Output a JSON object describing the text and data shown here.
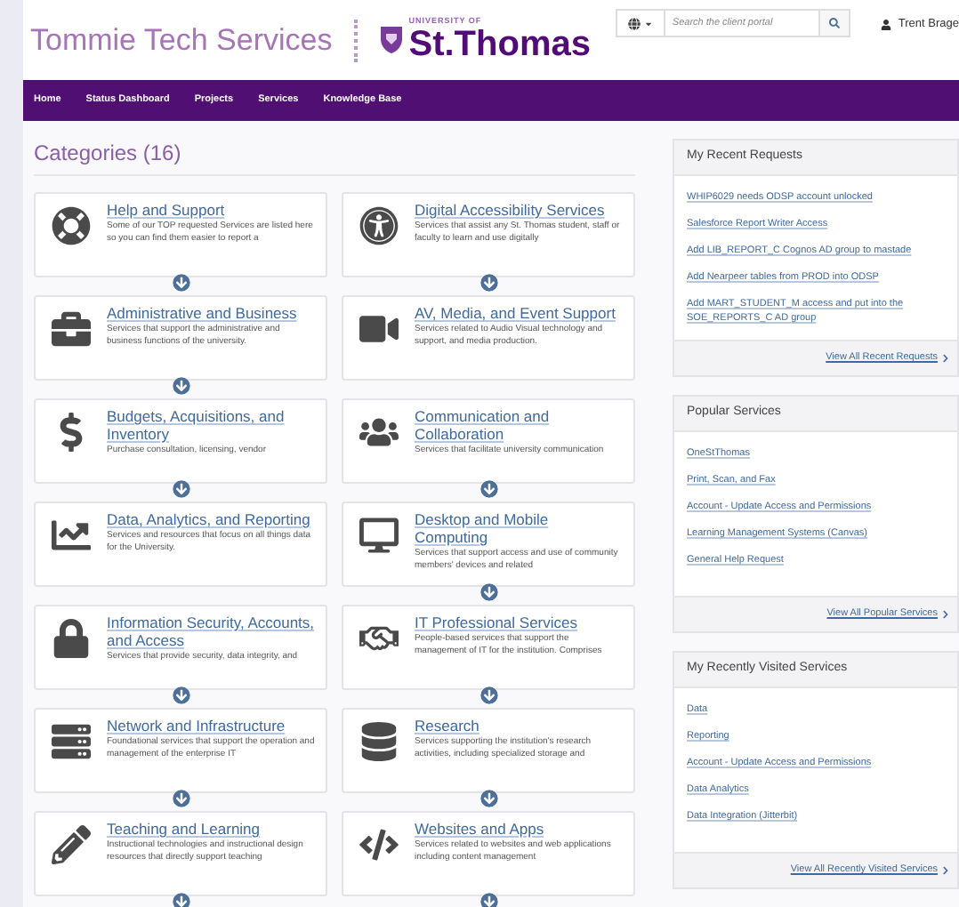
{
  "header": {
    "site_title": "Tommie Tech Services",
    "logo_small": "UNIVERSITY OF",
    "logo_name": "St.Thomas",
    "search": {
      "placeholder": "Search the client portal"
    },
    "user": "Trent Brage"
  },
  "nav": [
    {
      "label": "Home"
    },
    {
      "label": "Status Dashboard"
    },
    {
      "label": "Projects"
    },
    {
      "label": "Services"
    },
    {
      "label": "Knowledge Base"
    }
  ],
  "categories_title": "Categories (16)",
  "categories": [
    {
      "title": "Help and Support",
      "description": "Some of our TOP requested Services are listed here so you can find them easier to report a",
      "expandable": true
    },
    {
      "title": "Digital Accessibility Services",
      "description": "Services that assist any St. Thomas student, staff or faculty to learn and use digitally",
      "expandable": true
    },
    {
      "title": "Administrative and Business",
      "description": "Services that support the administrative and business functions of the university.",
      "expandable": true
    },
    {
      "title": "AV, Media, and Event Support",
      "description": "Services related to Audio Visual technology and support, and media production.",
      "expandable": false
    },
    {
      "title": "Budgets, Acquisitions, and Inventory",
      "description": "Purchase consultation, licensing, vendor",
      "expandable": true
    },
    {
      "title": "Communication and Collaboration",
      "description": "Services that facilitate university communication",
      "expandable": true
    },
    {
      "title": "Data, Analytics, and Reporting",
      "description": "Services and resources that focus on all things data for the University.",
      "expandable": false
    },
    {
      "title": "Desktop and Mobile Computing",
      "description": "Services that support access and use of community members' devices and related",
      "expandable": true
    },
    {
      "title": "Information Security, Accounts, and Access",
      "description": "Services that provide security, data integrity, and",
      "expandable": true
    },
    {
      "title": "IT Professional Services",
      "description": "People-based services that support the management of IT for the institution. Comprises",
      "expandable": true
    },
    {
      "title": "Network and Infrastructure",
      "description": "Foundational services that support the operation and management of the enterprise IT",
      "expandable": true
    },
    {
      "title": "Research",
      "description": "Services supporting the institution's research activities, including specialized storage and",
      "expandable": true
    },
    {
      "title": "Teaching and Learning",
      "description": "Instructional technologies and instructional design resources that directly support teaching",
      "expandable": true
    },
    {
      "title": "Websites and Apps",
      "description": "Services related to websites and web applications including content management",
      "expandable": true
    }
  ],
  "panels": [
    {
      "title": "My Recent Requests",
      "links": [
        "WHIP6029 needs ODSP account unlocked",
        "Salesforce Report Writer Access",
        "Add LIB_REPORT_C Cognos AD group to mastade",
        "Add Nearpeer tables from PROD into ODSP",
        "Add MART_STUDENT_M access and put into the SOE_REPORTS_C AD group"
      ],
      "footer": "View All Recent Requests"
    },
    {
      "title": "Popular Services",
      "links": [
        "OneStThomas",
        "Print, Scan, and Fax",
        "Account - Update Access and Permissions",
        "Learning Management Systems (Canvas)",
        "General Help Request"
      ],
      "footer": "View All Popular Services"
    },
    {
      "title": "My Recently Visited Services",
      "links": [
        "Data",
        "Reporting",
        "Account - Update Access and Permissions",
        "Data Analytics",
        "Data Integration (Jitterbit)"
      ],
      "footer": "View All Recently Visited Services"
    }
  ]
}
